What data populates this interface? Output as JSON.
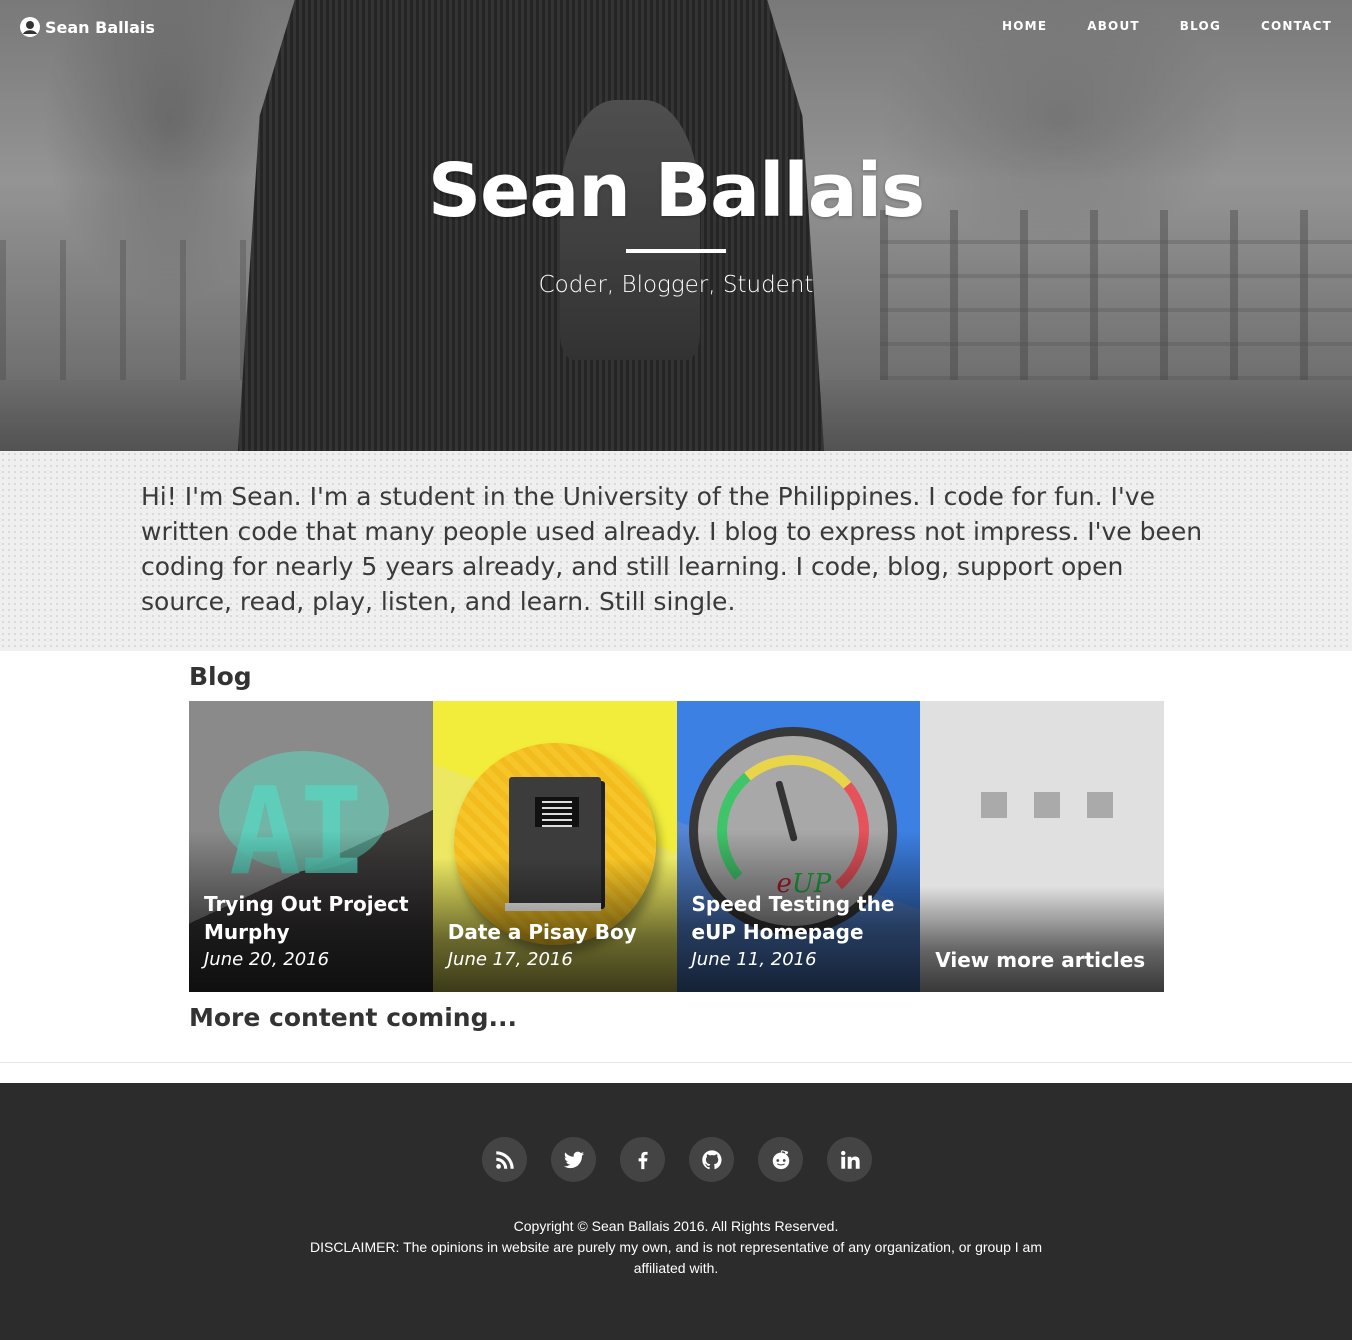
{
  "nav": {
    "brand": "Sean Ballais",
    "links": [
      "HOME",
      "ABOUT",
      "BLOG",
      "CONTACT"
    ]
  },
  "hero": {
    "title": "Sean Ballais",
    "subtitle": "Coder, Blogger, Student"
  },
  "intro": {
    "text": "Hi! I'm Sean. I'm a student in the University of the Philippines. I code for fun. I've written code that many people used already. I blog to express not impress. I've been coding for nearly 5 years already, and still learning. I code, blog, support open source, read, play, listen, and learn. Still single."
  },
  "blog": {
    "heading": "Blog",
    "posts": [
      {
        "title": "Trying Out Project Murphy",
        "date": "June 20, 2016",
        "art_text": "AI"
      },
      {
        "title": "Date a Pisay Boy",
        "date": "June 17, 2016"
      },
      {
        "title": "Speed Testing the eUP Homepage",
        "date": "June 11, 2016",
        "art_text_e": "e",
        "art_text_up": "UP"
      }
    ],
    "more_card": "View more articles",
    "more_content": "More content coming..."
  },
  "footer": {
    "social": [
      "rss-icon",
      "twitter-icon",
      "facebook-icon",
      "github-icon",
      "reddit-icon",
      "linkedin-icon"
    ],
    "copyright": "Copyright © Sean Ballais 2016. All Rights Reserved.",
    "disclaimer": "DISCLAIMER: The opinions in website are purely my own, and is not representative of any organization, or group I am affiliated with."
  },
  "colors": {
    "footer_bg": "#2d2c2c",
    "social_bg": "#454444",
    "card_yellow": "#f2ed3a",
    "card_blue": "#3d80e4",
    "card_gray": "#e0e0e0"
  }
}
